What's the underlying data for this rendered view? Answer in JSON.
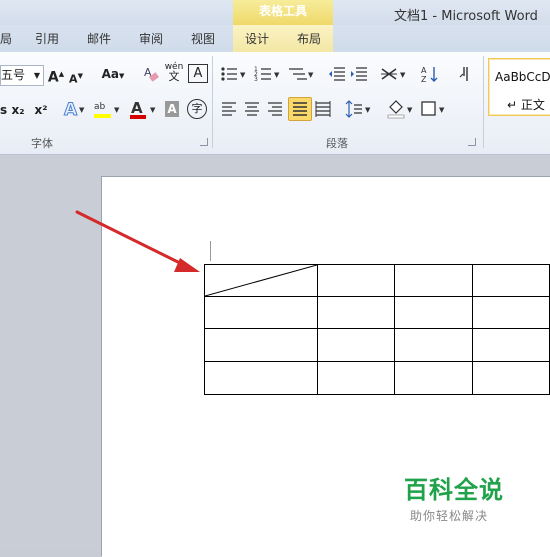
{
  "window": {
    "title": "文档1 - Microsoft Word"
  },
  "context_tab": {
    "label": "表格工具"
  },
  "tabs": [
    {
      "label": "局"
    },
    {
      "label": "引用"
    },
    {
      "label": "邮件"
    },
    {
      "label": "审阅"
    },
    {
      "label": "视图"
    },
    {
      "label": "设计"
    },
    {
      "label": "布局"
    }
  ],
  "font_group": {
    "label": "字体",
    "font_size": "五号",
    "grow_font": "A",
    "shrink_font": "A",
    "change_case": "Aa",
    "pinyin_guide": "wén",
    "char_border": "A",
    "subscript": "x₂",
    "superscript": "x²",
    "font_color_letter": "A",
    "char_shading": "A",
    "enclose_char": "字"
  },
  "paragraph_group": {
    "label": "段落"
  },
  "styles_group": {
    "preview": "AaBbCcDc",
    "name": "↵ 正文"
  },
  "watermark": {
    "title": "百科全说",
    "subtitle": "助你轻松解决"
  },
  "colors": {
    "accent_red": "#d42a2a",
    "watermark_green": "#1fa24a",
    "highlight_yellow": "#ffff00",
    "font_color_red": "#d40000"
  }
}
